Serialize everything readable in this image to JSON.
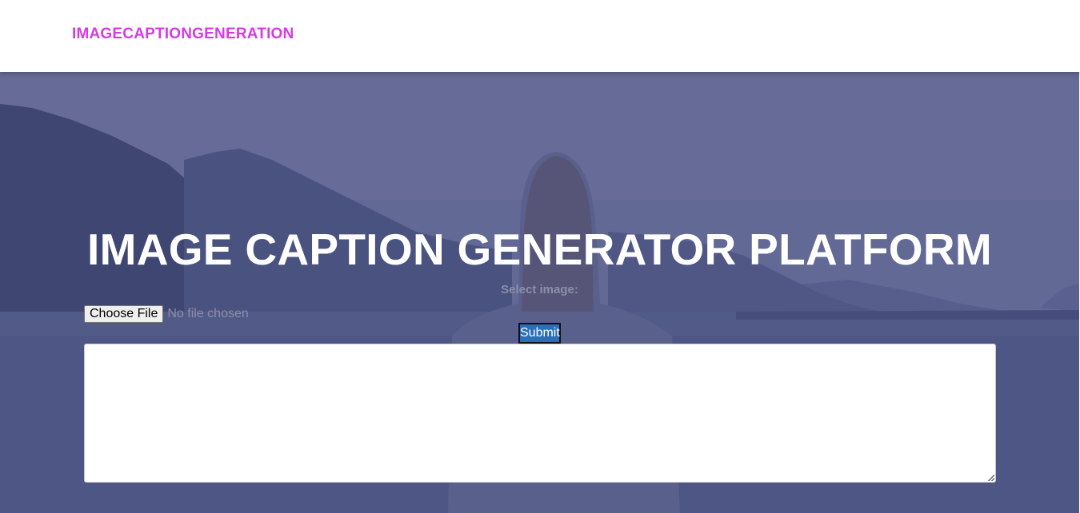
{
  "navbar": {
    "brand": "IMAGECAPTIONGENERATION"
  },
  "hero": {
    "title": "IMAGE CAPTION GENERATOR PLATFORM",
    "select_label": "Select image:",
    "file_input": {
      "button_label": "Choose File",
      "status_text": "No file chosen"
    },
    "submit_label": "Submit",
    "output": {
      "value": "",
      "placeholder": ""
    }
  },
  "colors": {
    "brand": "#d63ae6",
    "overlay": "#5c628f",
    "submit": "#2a6fb8",
    "title": "#ffffff"
  },
  "icons": {
    "background": "hero-background-image",
    "textarea_grip": "resize-grip-icon"
  }
}
